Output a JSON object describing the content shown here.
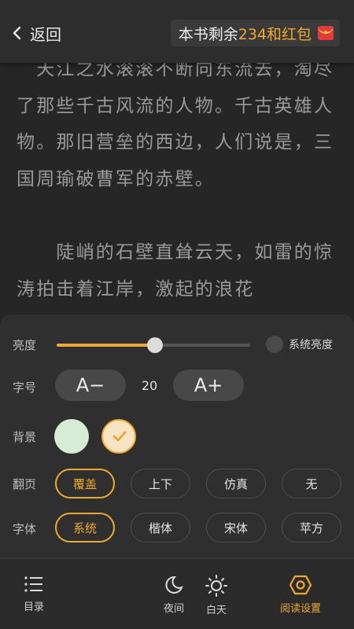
{
  "header": {
    "back_label": "返回",
    "promo_prefix": "本书剩余",
    "promo_highlight": "234和红包",
    "promo_icon": "red-packet-icon"
  },
  "reader": {
    "paragraphs": [
      "　天江之水滚滚不断向东流去，淘尽了那些千古风流的人物。千古英雄人物。那旧营垒的西边，人们说是，三国周瑜破曹军的赤壁。",
      "　　陡峭的石壁直耸云天，如雷的惊涛拍击着江岸，激起的浪花"
    ]
  },
  "settings": {
    "brightness": {
      "label": "亮度",
      "value_percent": 51,
      "system_label": "系统亮度"
    },
    "font_size": {
      "label": "字号",
      "decrease_label": "A−",
      "value": "20",
      "increase_label": "A+"
    },
    "background": {
      "label": "背景",
      "options": [
        {
          "color": "#d6ecd4",
          "selected": false
        },
        {
          "color": "#f7e4c2",
          "selected": true
        }
      ]
    },
    "page_turn": {
      "label": "翻页",
      "options": [
        "覆盖",
        "上下",
        "仿真",
        "无"
      ],
      "selected": "覆盖"
    },
    "font": {
      "label": "字体",
      "options": [
        "系统",
        "楷体",
        "宋体",
        "苹方"
      ],
      "selected": "系统"
    }
  },
  "nav": {
    "items": [
      {
        "label": "目录",
        "icon": "list-icon"
      },
      {
        "label": "夜间",
        "icon": "moon-icon"
      },
      {
        "label": "白天",
        "icon": "sun-icon"
      },
      {
        "label": "阅读设置",
        "icon": "settings-hexagon-icon",
        "active": true
      }
    ]
  },
  "colors": {
    "accent": "#f0a830",
    "panel": "#2f2f2f",
    "page": "#262626"
  }
}
